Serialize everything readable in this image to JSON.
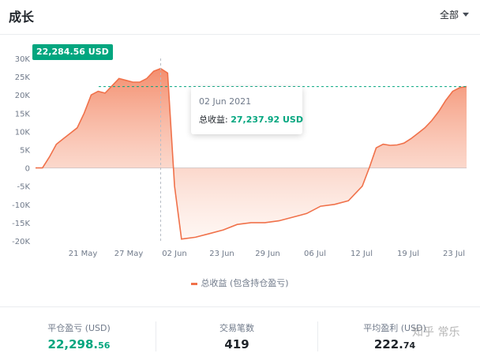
{
  "header": {
    "title": "成长",
    "filter_label": "全部"
  },
  "chart_data": {
    "type": "area",
    "series": [
      {
        "name": "总收益 (包含持仓盈亏)",
        "color": "#f0714a",
        "values": [
          [
            "2021-05-15",
            0
          ],
          [
            "2021-05-16",
            0
          ],
          [
            "2021-05-17",
            3000
          ],
          [
            "2021-05-18",
            6500
          ],
          [
            "2021-05-19",
            8000
          ],
          [
            "2021-05-20",
            9500
          ],
          [
            "2021-05-21",
            11000
          ],
          [
            "2021-05-22",
            15000
          ],
          [
            "2021-05-23",
            20000
          ],
          [
            "2021-05-24",
            21000
          ],
          [
            "2021-05-25",
            20500
          ],
          [
            "2021-05-26",
            22500
          ],
          [
            "2021-05-27",
            24500
          ],
          [
            "2021-05-28",
            24000
          ],
          [
            "2021-05-29",
            23500
          ],
          [
            "2021-05-30",
            23500
          ],
          [
            "2021-05-31",
            24500
          ],
          [
            "2021-06-01",
            26500
          ],
          [
            "2021-06-02",
            27237.92
          ],
          [
            "2021-06-03",
            26000
          ],
          [
            "2021-06-04",
            -5000
          ],
          [
            "2021-06-05",
            -19500
          ],
          [
            "2021-06-07",
            -19000
          ],
          [
            "2021-06-09",
            -18000
          ],
          [
            "2021-06-11",
            -17000
          ],
          [
            "2021-06-13",
            -15500
          ],
          [
            "2021-06-15",
            -15000
          ],
          [
            "2021-06-17",
            -15000
          ],
          [
            "2021-06-19",
            -14500
          ],
          [
            "2021-06-21",
            -13500
          ],
          [
            "2021-06-23",
            -12500
          ],
          [
            "2021-06-25",
            -10500
          ],
          [
            "2021-06-27",
            -10000
          ],
          [
            "2021-06-29",
            -9000
          ],
          [
            "2021-07-01",
            -5000
          ],
          [
            "2021-07-02",
            0
          ],
          [
            "2021-07-03",
            5500
          ],
          [
            "2021-07-04",
            6500
          ],
          [
            "2021-07-05",
            6200
          ],
          [
            "2021-07-06",
            6300
          ],
          [
            "2021-07-07",
            6800
          ],
          [
            "2021-07-08",
            8000
          ],
          [
            "2021-07-09",
            9500
          ],
          [
            "2021-07-10",
            11000
          ],
          [
            "2021-07-11",
            13000
          ],
          [
            "2021-07-12",
            15500
          ],
          [
            "2021-07-13",
            18500
          ],
          [
            "2021-07-14",
            21000
          ],
          [
            "2021-07-15",
            22000
          ],
          [
            "2021-07-16",
            22284.56
          ]
        ]
      }
    ],
    "x_ticks": [
      "21 May",
      "27 May",
      "02 Jun",
      "23 Jun",
      "29 Jun",
      "06 Jul",
      "12 Jul",
      "19 Jul",
      "23 Jul"
    ],
    "y_ticks": [
      "30K",
      "25K",
      "20K",
      "15K",
      "10K",
      "5K",
      "0",
      "-5K",
      "-10K",
      "-15K",
      "-20K"
    ],
    "ylim": [
      -20000,
      30000
    ],
    "current_value": 22284.56,
    "current_label": "22,284.56 USD",
    "tooltip": {
      "date": "02 Jun 2021",
      "label": "总收益:",
      "value": "27,237.92 USD"
    },
    "legend_label": "总收益 (包含持仓盈亏)",
    "legend_position": "bottom-center",
    "grid": false
  },
  "stats": [
    {
      "label": "平仓盈亏 (USD)",
      "value_main": "22,298.",
      "value_small": "56",
      "color": "#02a67f"
    },
    {
      "label": "交易笔数",
      "value_main": "419",
      "value_small": "",
      "color": "#1e2329"
    },
    {
      "label": "平均盈利 (USD)",
      "value_main": "222.",
      "value_small": "74",
      "color": "#1e2329"
    }
  ],
  "watermark": "知乎 常乐"
}
